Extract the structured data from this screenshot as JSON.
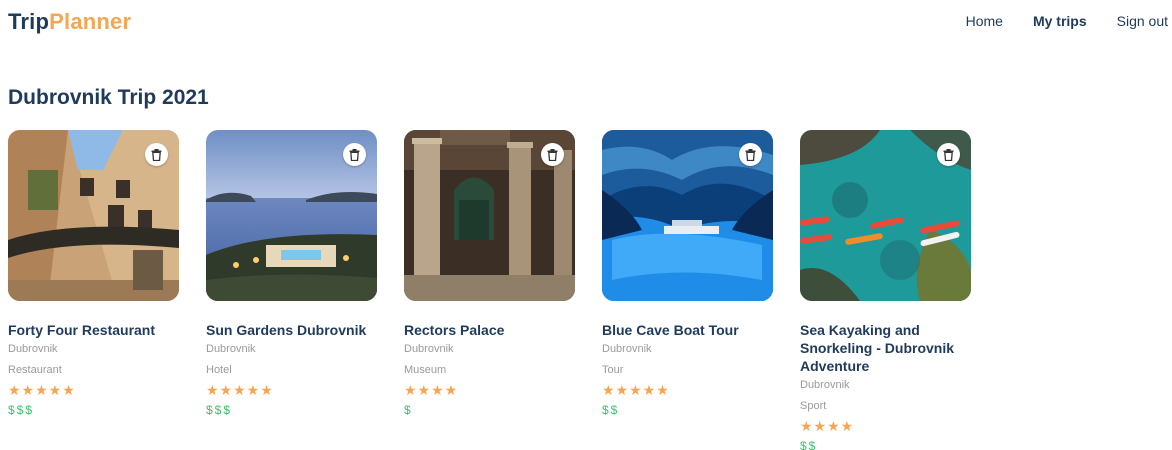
{
  "header": {
    "logo_part1": "Trip",
    "logo_part2": "Planner",
    "nav": [
      {
        "label": "Home",
        "active": false
      },
      {
        "label": "My trips",
        "active": true
      },
      {
        "label": "Sign out",
        "active": false
      }
    ]
  },
  "page": {
    "title": "Dubrovnik Trip 2021"
  },
  "cards": [
    {
      "name": "Forty Four Restaurant",
      "city": "Dubrovnik",
      "type": "Restaurant",
      "stars": "★★★★★",
      "price": "$$$",
      "rating": 5
    },
    {
      "name": "Sun Gardens Dubrovnik",
      "city": "Dubrovnik",
      "type": "Hotel",
      "stars": "★★★★★",
      "price": "$$$",
      "rating": 5
    },
    {
      "name": "Rectors Palace",
      "city": "Dubrovnik",
      "type": "Museum",
      "stars": "★★★★",
      "price": "$",
      "rating": 4
    },
    {
      "name": "Blue Cave Boat Tour",
      "city": "Dubrovnik",
      "type": "Tour",
      "stars": "★★★★★",
      "price": "$$",
      "rating": 5
    },
    {
      "name": "Sea Kayaking and Snorkeling - Dubrovnik Adventure",
      "city": "Dubrovnik",
      "type": "Sport",
      "stars": "★★★★",
      "price": "$$",
      "rating": 4
    }
  ],
  "colors": {
    "brand_dark": "#1f3a5a",
    "brand_accent": "#f4a654",
    "price_green": "#3cc16b",
    "muted_text": "#9a9a9a"
  },
  "icons": {
    "delete": "trash-icon"
  }
}
